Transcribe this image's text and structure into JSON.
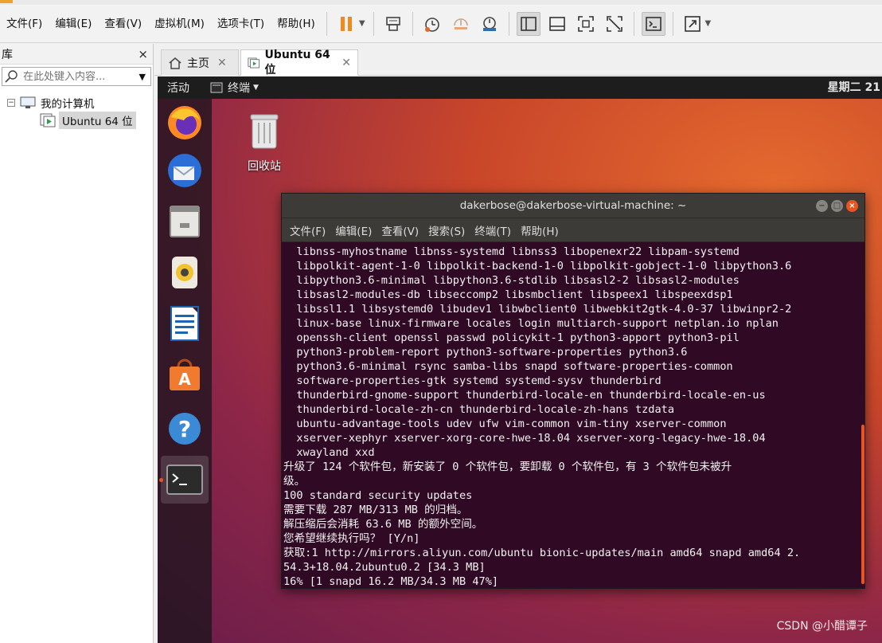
{
  "menubar": {
    "items": [
      "文件(F)",
      "编辑(E)",
      "查看(V)",
      "虚拟机(M)",
      "选项卡(T)",
      "帮助(H)"
    ]
  },
  "toolbar": {
    "buttons": [
      "pause-icon",
      "send-ctrl-alt-del-icon",
      "snapshot-icon",
      "revert-snapshot-icon",
      "snapshot-manager-icon",
      "library-view-icon",
      "thumbnail-view-icon",
      "fullscreen-icon",
      "unity-icon",
      "console-view-icon",
      "stretch-icon"
    ],
    "accent_color": "#f0a030"
  },
  "library": {
    "title": "库",
    "close_label": "×",
    "search_placeholder": "在此处键入内容...",
    "tree": {
      "root_label": "我的计算机",
      "vm_label": "Ubuntu 64 位"
    }
  },
  "tabs": [
    {
      "label": "主页",
      "active": false
    },
    {
      "label": "Ubuntu 64 位",
      "active": true
    }
  ],
  "guest": {
    "top_bar": {
      "activities": "活动",
      "app_name": "终端",
      "clock": "星期二 21"
    },
    "dock": [
      "firefox-icon",
      "thunderbird-icon",
      "files-icon",
      "rhythmbox-icon",
      "libreoffice-writer-icon",
      "ubuntu-software-icon",
      "help-icon",
      "terminal-icon"
    ],
    "desktop_icons": [
      {
        "label": "回收站",
        "icon": "trash-icon"
      }
    ],
    "accent_color": "#e95420"
  },
  "terminal": {
    "title": "dakerbose@dakerbose-virtual-machine: ~",
    "menu": [
      "文件(F)",
      "编辑(E)",
      "查看(V)",
      "搜索(S)",
      "终端(T)",
      "帮助(H)"
    ],
    "lines": [
      "  libnss-myhostname libnss-systemd libnss3 libopenexr22 libpam-systemd",
      "  libpolkit-agent-1-0 libpolkit-backend-1-0 libpolkit-gobject-1-0 libpython3.6",
      "  libpython3.6-minimal libpython3.6-stdlib libsasl2-2 libsasl2-modules",
      "  libsasl2-modules-db libseccomp2 libsmbclient libspeex1 libspeexdsp1",
      "  libssl1.1 libsystemd0 libudev1 libwbclient0 libwebkit2gtk-4.0-37 libwinpr2-2",
      "  linux-base linux-firmware locales login multiarch-support netplan.io nplan",
      "  openssh-client openssl passwd policykit-1 python3-apport python3-pil",
      "  python3-problem-report python3-software-properties python3.6",
      "  python3.6-minimal rsync samba-libs snapd software-properties-common",
      "  software-properties-gtk systemd systemd-sysv thunderbird",
      "  thunderbird-gnome-support thunderbird-locale-en thunderbird-locale-en-us",
      "  thunderbird-locale-zh-cn thunderbird-locale-zh-hans tzdata",
      "  ubuntu-advantage-tools udev ufw vim-common vim-tiny xserver-common",
      "  xserver-xephyr xserver-xorg-core-hwe-18.04 xserver-xorg-legacy-hwe-18.04",
      "  xwayland xxd",
      "升级了 124 个软件包，新安装了 0 个软件包，要卸载 0 个软件包，有 3 个软件包未被升",
      "级。",
      "100 standard security updates",
      "需要下载 287 MB/313 MB 的归档。",
      "解压缩后会消耗 63.6 MB 的额外空间。",
      "您希望继续执行吗？ [Y/n]",
      "获取:1 http://mirrors.aliyun.com/ubuntu bionic-updates/main amd64 snapd amd64 2.",
      "54.3+18.04.2ubuntu0.2 [34.3 MB]",
      "16% [1 snapd 16.2 MB/34.3 MB 47%]"
    ]
  },
  "watermark": "CSDN @小醋谭子"
}
